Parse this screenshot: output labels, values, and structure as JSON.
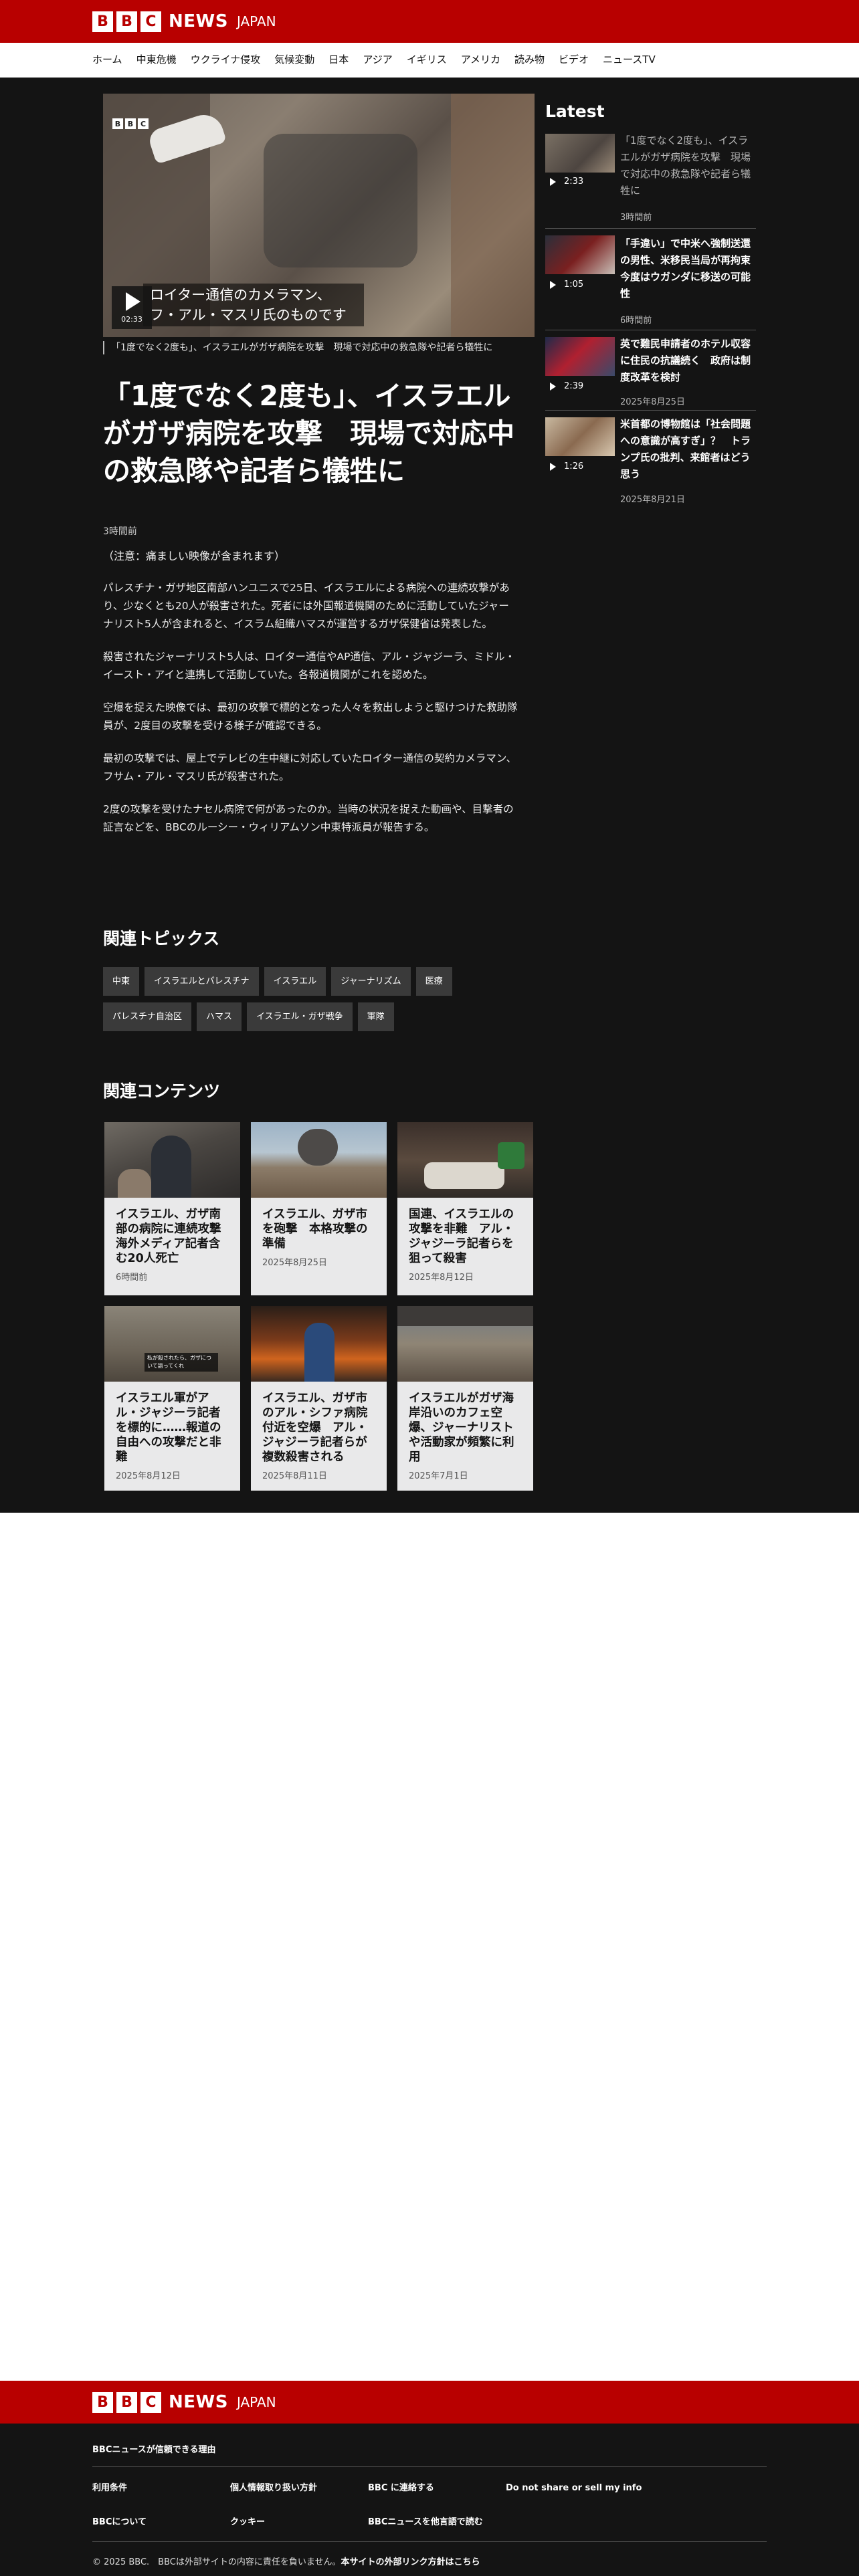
{
  "header": {
    "logo_letters": [
      "B",
      "B",
      "C"
    ],
    "logo_news": "NEWS",
    "logo_region": "JAPAN"
  },
  "nav": [
    "ホーム",
    "中東危機",
    "ウクライナ侵攻",
    "気候変動",
    "日本",
    "アジア",
    "イギリス",
    "アメリカ",
    "読み物",
    "ビデオ",
    "ニュースTV"
  ],
  "video": {
    "overlay_caption": "ロイター通信のカメラマン、フ・アル・マスリ氏のものです",
    "duration": "02:33",
    "caption": "「1度でなく2度も」、イスラエルがガザ病院を攻撃　現場で対応中の救急隊や記者ら犠牲に"
  },
  "article": {
    "headline": "「1度でなく2度も」、イスラエルがガザ病院を攻撃　現場で対応中の救急隊や記者ら犠牲に",
    "timestamp": "3時間前",
    "warning": "（注意：痛ましい映像が含まれます）",
    "paragraphs": [
      "パレスチナ・ガザ地区南部ハンユニスで25日、イスラエルによる病院への連続攻撃があり、少なくとも20人が殺害された。死者には外国報道機関のために活動していたジャーナリスト5人が含まれると、イスラム組織ハマスが運営するガザ保健省は発表した。",
      "殺害されたジャーナリスト5人は、ロイター通信やAP通信、アル・ジャジーラ、ミドル・イースト・アイと連携して活動していた。各報道機関がこれを認めた。",
      "空爆を捉えた映像では、最初の攻撃で標的となった人々を救出しようと駆けつけた救助隊員が、2度目の攻撃を受ける様子が確認できる。",
      "最初の攻撃では、屋上でテレビの生中継に対応していたロイター通信の契約カメラマン、フサム・アル・マスリ氏が殺害された。",
      "2度の攻撃を受けたナセル病院で何があったのか。当時の状況を捉えた動画や、目撃者の証言などを、BBCのルーシー・ウィリアムソン中東特派員が報告する。"
    ]
  },
  "topics": {
    "title": "関連トピックス",
    "chips": [
      "中東",
      "イスラエルとパレスチナ",
      "イスラエル",
      "ジャーナリズム",
      "医療",
      "パレスチナ自治区",
      "ハマス",
      "イスラエル・ガザ戦争",
      "軍隊"
    ]
  },
  "related": {
    "title": "関連コンテンツ",
    "cards": [
      {
        "title": "イスラエル、ガザ南部の病院に連続攻撃　海外メディア記者含む20人死亡",
        "date": "6時間前"
      },
      {
        "title": "イスラエル、ガザ市を砲撃　本格攻撃の準備",
        "date": "2025年8月25日"
      },
      {
        "title": "国連、イスラエルの攻撃を非難　アル・ジャジーラ記者らを狙って殺害",
        "date": "2025年8月12日"
      },
      {
        "title": "イスラエル軍がアル・ジャジーラ記者を標的に……報道の自由への攻撃だと非難",
        "date": "2025年8月12日",
        "thumb_text": "私が殺されたら、ガザについて語ってくれ"
      },
      {
        "title": "イスラエル、ガザ市のアル・シファ病院付近を空爆　アル・ジャジーラ記者らが複数殺害される",
        "date": "2025年8月11日"
      },
      {
        "title": "イスラエルがガザ海岸沿いのカフェ空爆、ジャーナリストや活動家が頻繁に利用",
        "date": "2025年7月1日"
      }
    ]
  },
  "latest": {
    "title": "Latest",
    "items": [
      {
        "title": "「1度でなく2度も」、イスラエルがガザ病院を攻撃　現場で対応中の救急隊や記者ら犠牲に",
        "duration": "2:33",
        "date": "3時間前"
      },
      {
        "title": "「手違い」で中米へ強制送還の男性、米移民当局が再拘束　今度はウガンダに移送の可能性",
        "duration": "1:05",
        "date": "6時間前"
      },
      {
        "title": "英で難民申請者のホテル収容に住民の抗議続く　政府は制度改革を検討",
        "duration": "2:39",
        "date": "2025年8月25日"
      },
      {
        "title": "米首都の博物館は「社会問題への意識が高すぎ」？　トランプ氏の批判、来館者はどう思う",
        "duration": "1:26",
        "date": "2025年8月21日"
      }
    ]
  },
  "footer": {
    "trust": "BBCニュースが信頼できる理由",
    "links": [
      "利用条件",
      "個人情報取り扱い方針",
      "BBC に連絡する",
      "Do not share or sell my info",
      "BBCについて",
      "クッキー",
      "BBCニュースを他言語で読む"
    ],
    "copyright": "© 2025 BBC.　BBCは外部サイトの内容に責任を負いません。",
    "copyright_link": "本サイトの外部リンク方針はこちら"
  },
  "colors": {
    "brand_red": "#b80000",
    "dark_bg": "#141414",
    "card_bg": "#e9e9ea"
  }
}
